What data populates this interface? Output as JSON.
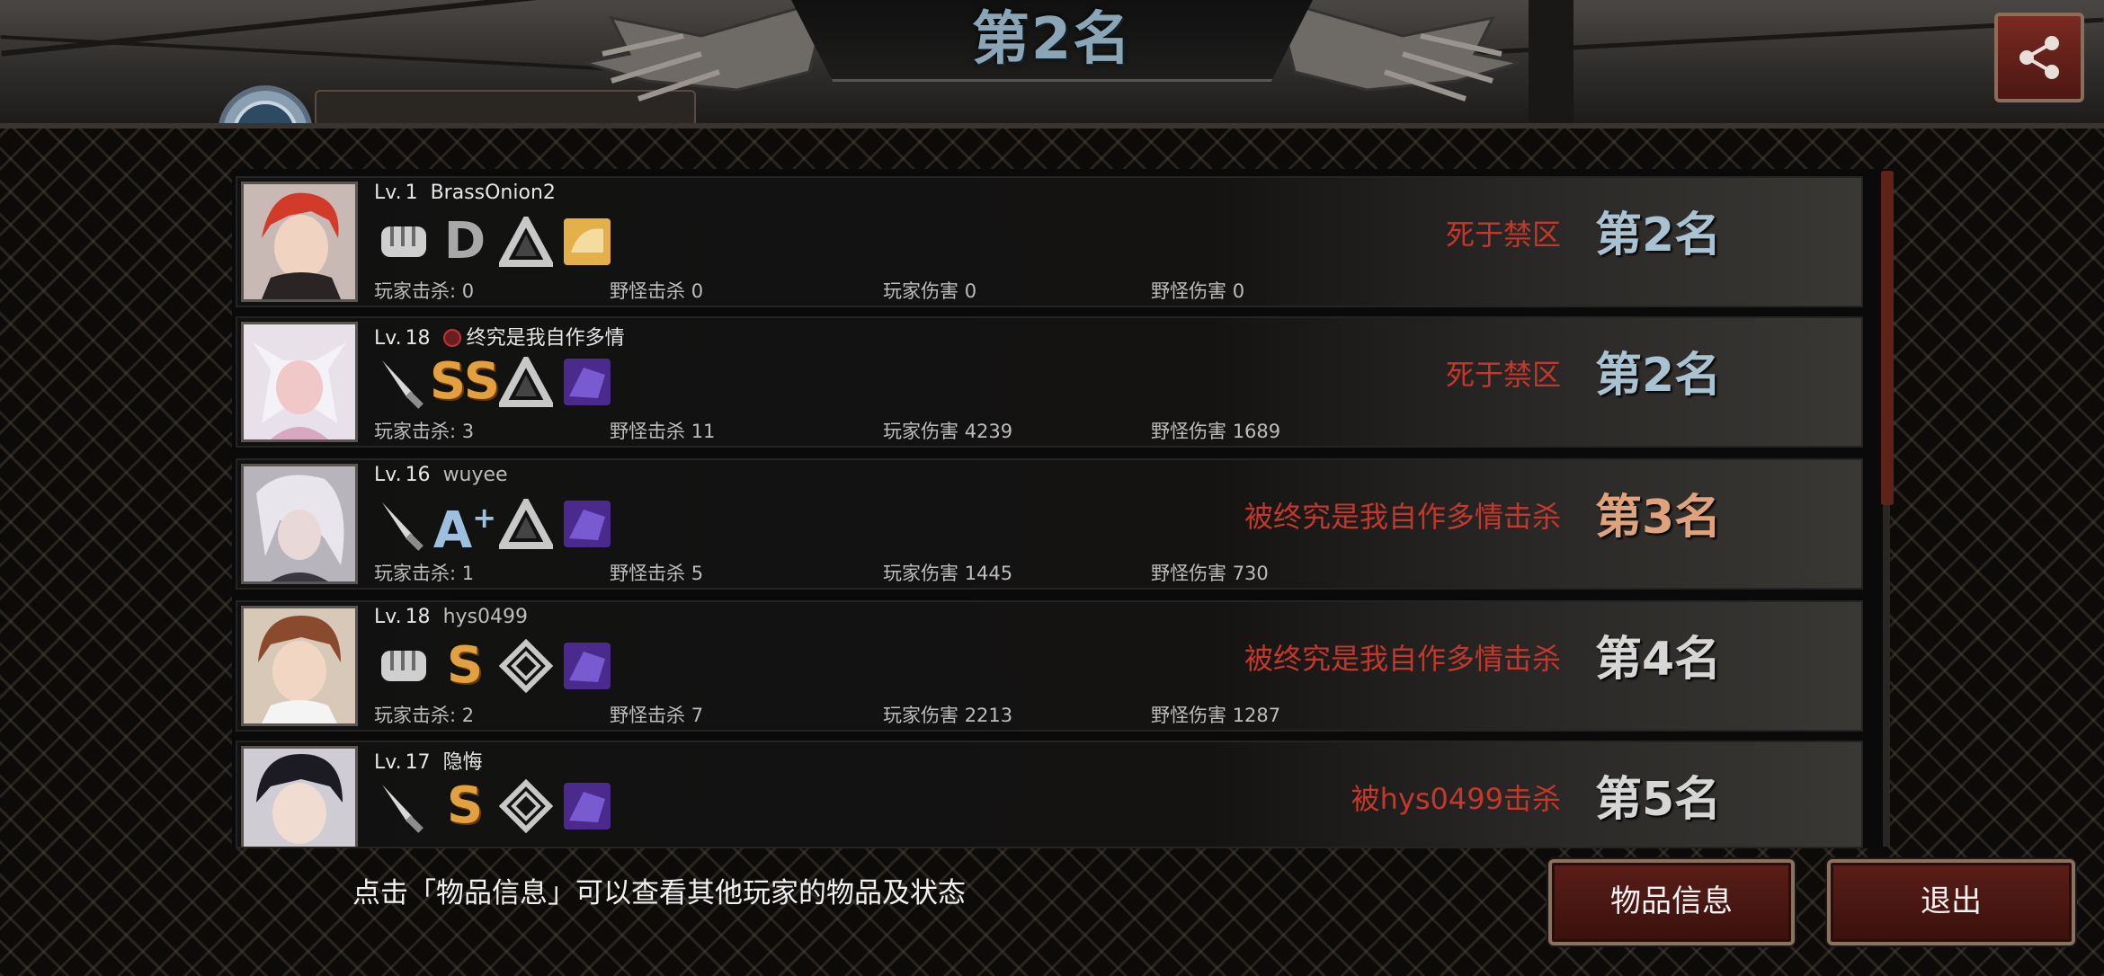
{
  "header": {
    "title": "第2名",
    "tag_text": "终究是我自作多情"
  },
  "colors": {
    "accent_red": "#c4382b",
    "rank_blue": "#a8c2d2",
    "rank_orange": "#e0a27a",
    "grade_gold": "#e2a040"
  },
  "stat_labels": {
    "player_kills": "玩家击杀:",
    "monster_kills": "野怪击杀",
    "player_damage": "玩家伤害",
    "monster_damage": "野怪伤害"
  },
  "rows": [
    {
      "lv_label": "Lv.",
      "level": "1",
      "name": "BrassOnion2",
      "weapon_icon": "fist-icon",
      "grade": "D",
      "class_icon": "triangle-emblem-icon",
      "item_icon": "bread-item-icon",
      "player_kills": "0",
      "monster_kills": "0",
      "player_damage": "0",
      "monster_damage": "0",
      "death": "死于禁区",
      "rank": "第2名"
    },
    {
      "lv_label": "Lv.",
      "level": "18",
      "name": "终究是我自作多情",
      "weapon_icon": "knife-icon",
      "grade": "SS",
      "class_icon": "triangle-emblem-icon",
      "item_icon": "purple-creature-item-icon",
      "player_kills": "3",
      "monster_kills": "11",
      "player_damage": "4239",
      "monster_damage": "1689",
      "death": "死于禁区",
      "rank": "第2名"
    },
    {
      "lv_label": "Lv.",
      "level": "16",
      "name": "wuyee",
      "weapon_icon": "knife-icon",
      "grade": "A",
      "grade_sup": "+",
      "class_icon": "triangle-emblem-icon",
      "item_icon": "purple-creature-item-icon",
      "player_kills": "1",
      "monster_kills": "5",
      "player_damage": "1445",
      "monster_damage": "730",
      "death": "被终究是我自作多情击杀",
      "rank": "第3名"
    },
    {
      "lv_label": "Lv.",
      "level": "18",
      "name": "hys0499",
      "weapon_icon": "fist-icon",
      "grade": "S",
      "class_icon": "diamond-emblem-icon",
      "item_icon": "purple-creature-item-icon",
      "player_kills": "2",
      "monster_kills": "7",
      "player_damage": "2213",
      "monster_damage": "1287",
      "death": "被终究是我自作多情击杀",
      "rank": "第4名"
    },
    {
      "lv_label": "Lv.",
      "level": "17",
      "name": "隐悔",
      "weapon_icon": "knife-icon",
      "grade": "S",
      "class_icon": "diamond-emblem-icon",
      "item_icon": "purple-creature-item-icon",
      "death": "被hys0499击杀",
      "rank": "第5名"
    }
  ],
  "footer": {
    "hint": "点击「物品信息」可以查看其他玩家的物品及状态",
    "item_info_button": "物品信息",
    "exit_button": "退出"
  }
}
